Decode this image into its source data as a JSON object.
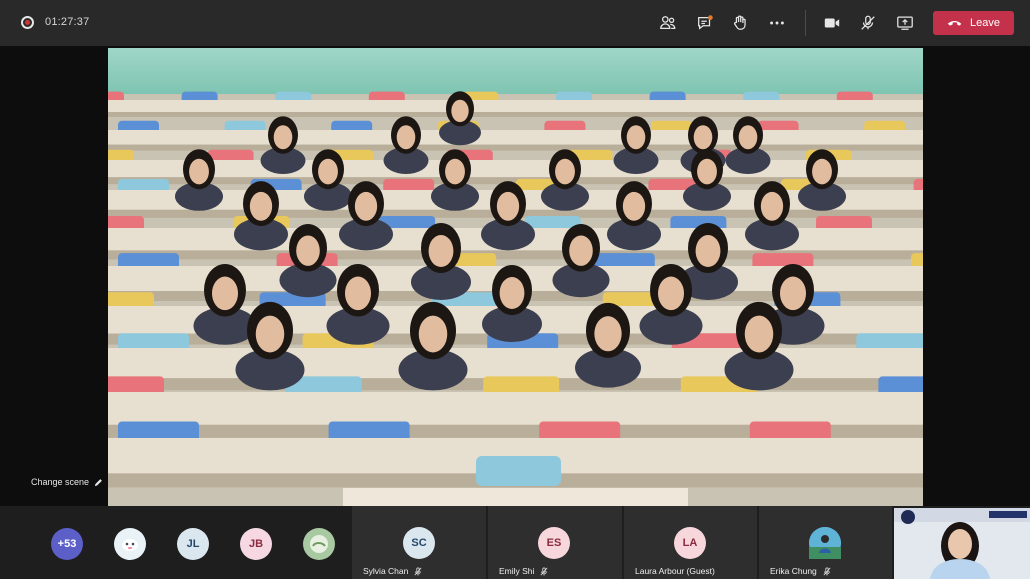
{
  "meeting": {
    "recording_time": "01:27:37",
    "leave_label": "Leave",
    "toolbar_icons": [
      "participants-icon",
      "chat-icon",
      "raise-hand-icon",
      "more-options-icon",
      "camera-icon",
      "mic-off-icon",
      "share-screen-icon"
    ]
  },
  "stage": {
    "change_scene_label": "Change scene"
  },
  "overflow": {
    "more_label": "+53"
  },
  "strip_avatars": [
    {
      "initials": "",
      "color": "#e9f3f7"
    },
    {
      "initials": "JL",
      "color": "#dbe7ee"
    },
    {
      "initials": "JB",
      "color": "#f6d8e3"
    },
    {
      "initials": "",
      "color": "#a8c9a1"
    }
  ],
  "participants": [
    {
      "name": "Sylvia Chan",
      "initials": "SC",
      "color": "#dbe7ee",
      "text_color": "#24486b"
    },
    {
      "name": "Emily Shi",
      "initials": "ES",
      "color": "#f7d6dc",
      "text_color": "#8a2b3f"
    },
    {
      "name": "Laura Arbour (Guest)",
      "initials": "LA",
      "color": "#f7d6dc",
      "text_color": "#8a2b3f"
    },
    {
      "name": "Erika Chung",
      "initials": "",
      "color": "#4aa3c9",
      "text_color": "#ffffff"
    }
  ],
  "colors": {
    "leave": "#c4314b",
    "more_badge": "#5b5fc7",
    "topbar": "#292929"
  }
}
